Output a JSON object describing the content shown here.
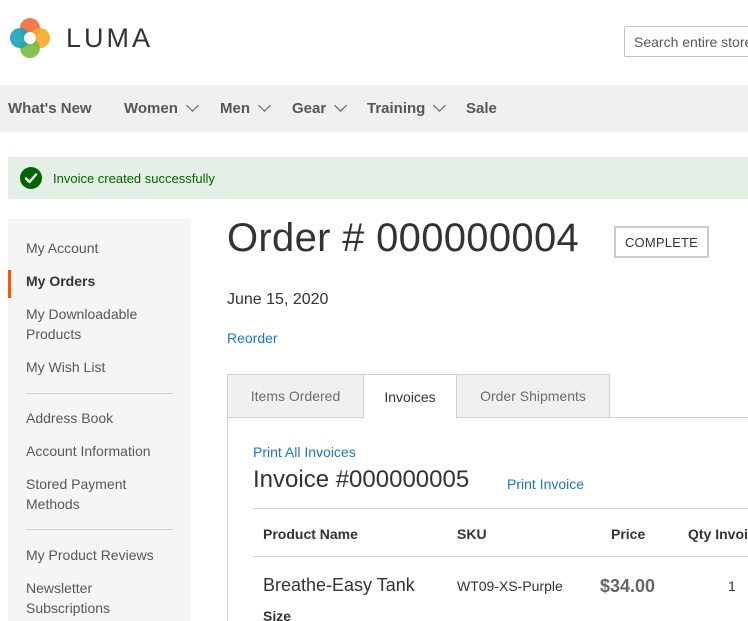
{
  "header": {
    "logo_text": "LUMA",
    "search": {
      "placeholder": "Search entire store here..."
    }
  },
  "nav": {
    "items": [
      {
        "label": "What's New",
        "has_submenu": false
      },
      {
        "label": "Women",
        "has_submenu": true
      },
      {
        "label": "Men",
        "has_submenu": true
      },
      {
        "label": "Gear",
        "has_submenu": true
      },
      {
        "label": "Training",
        "has_submenu": true
      },
      {
        "label": "Sale",
        "has_submenu": false
      }
    ]
  },
  "message": {
    "text": "Invoice created successfully",
    "icon": "checkmark-circle-icon",
    "color": "#006400"
  },
  "sidebar": {
    "items": [
      {
        "label": "My Account",
        "active": false
      },
      {
        "label": "My Orders",
        "active": true
      },
      {
        "label": "My Downloadable Products",
        "active": false
      },
      {
        "label": "My Wish List",
        "active": false
      },
      {
        "label": "Address Book",
        "active": false
      },
      {
        "label": "Account Information",
        "active": false
      },
      {
        "label": "Stored Payment Methods",
        "active": false
      },
      {
        "label": "My Product Reviews",
        "active": false
      },
      {
        "label": "Newsletter Subscriptions",
        "active": false
      }
    ],
    "active_color": "#ff5501"
  },
  "order": {
    "title": "Order # 000000004",
    "status": "COMPLETE",
    "date": "June 15, 2020",
    "reorder_label": "Reorder"
  },
  "tabs": [
    {
      "label": "Items Ordered",
      "active": false
    },
    {
      "label": "Invoices",
      "active": true
    },
    {
      "label": "Order Shipments",
      "active": false
    }
  ],
  "invoices": {
    "print_all_label": "Print All Invoices",
    "invoice_title": "Invoice #000000005",
    "print_invoice_label": "Print Invoice",
    "columns": [
      "Product Name",
      "SKU",
      "Price",
      "Qty Invoiced"
    ],
    "rows": [
      {
        "product_name": "Breathe-Easy Tank",
        "option_label": "Size",
        "sku": "WT09-XS-Purple",
        "price": "$34.00",
        "qty": "1"
      }
    ]
  },
  "colors": {
    "link": "#1979c3",
    "success_bg": "#e5efe5",
    "nav_bg": "#f0f0f0"
  }
}
